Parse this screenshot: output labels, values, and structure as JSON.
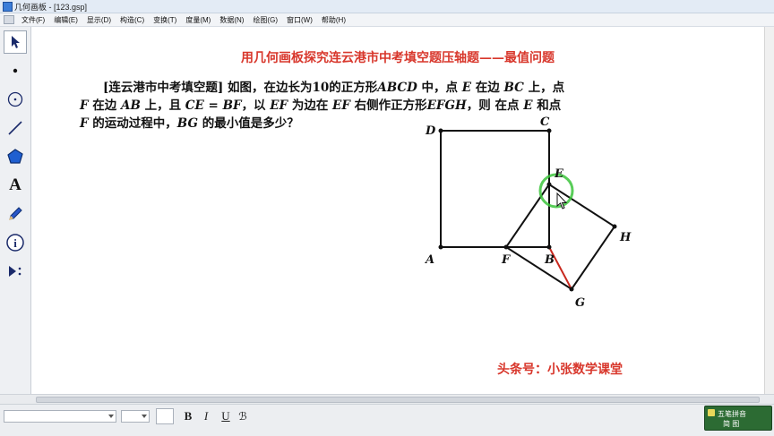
{
  "window": {
    "title": "几何画板 - [123.gsp]"
  },
  "menu": [
    "文件(F)",
    "编辑(E)",
    "显示(D)",
    "构造(C)",
    "变换(T)",
    "度量(M)",
    "数据(N)",
    "绘图(G)",
    "窗口(W)",
    "帮助(H)"
  ],
  "tools": [
    {
      "name": "arrow-select-tool",
      "icon": "arrow-icon"
    },
    {
      "name": "point-tool",
      "icon": "point-icon"
    },
    {
      "name": "compass-tool",
      "icon": "circle-icon"
    },
    {
      "name": "straightedge-tool",
      "icon": "segment-icon"
    },
    {
      "name": "polygon-tool",
      "icon": "polygon-icon"
    },
    {
      "name": "text-tool",
      "icon": "text-a-icon",
      "label": "A"
    },
    {
      "name": "marker-tool",
      "icon": "pencil-icon"
    },
    {
      "name": "information-tool",
      "icon": "info-icon",
      "label": "i"
    },
    {
      "name": "custom-tool",
      "icon": "play-more-icon"
    }
  ],
  "document": {
    "title": "用几何画板探究连云港市中考填空题压轴题——最值问题",
    "problem": {
      "l1": [
        "[连云港市中考填空题] 如图，在边长为10的正方形",
        "ABCD",
        " 中，点 ",
        "E",
        " 在边 ",
        "BC",
        " 上，点"
      ],
      "l2": [
        "F",
        " 在边 ",
        "AB",
        " 上，且 ",
        "CE",
        " = ",
        "BF",
        "，以 ",
        "EF",
        " 为边在 ",
        "EF",
        " 右侧作正方形",
        "EFGH",
        "，则 在点 ",
        "E",
        " 和点"
      ],
      "l3": [
        "F",
        " 的运动过程中，",
        "BG",
        " 的最小值是多少？"
      ]
    },
    "points": [
      "A",
      "B",
      "C",
      "D",
      "E",
      "F",
      "G",
      "H"
    ],
    "watermark": "头条号：小张数学课堂"
  },
  "format_bar": {
    "bold": "B",
    "italic": "I",
    "underline": "U",
    "special": "ℬ"
  },
  "ime": {
    "name": "五笔拼音",
    "mode": "简 图"
  },
  "colors": {
    "accent_red": "#d8372c",
    "highlight_circle": "#3cc43c",
    "segment_red": "#c8281e"
  }
}
